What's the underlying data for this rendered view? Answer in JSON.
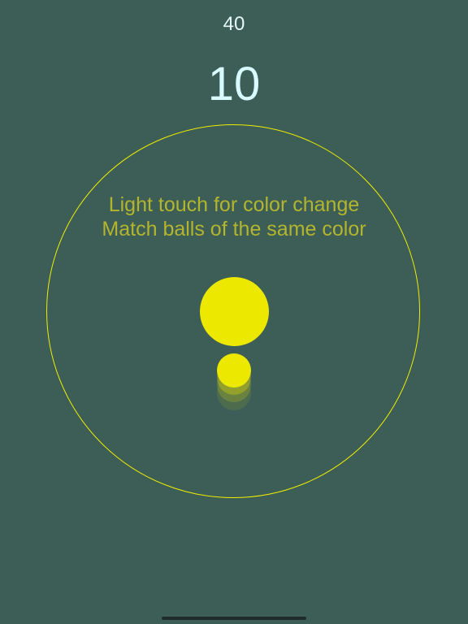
{
  "hud": {
    "best_score": "40",
    "score": "10"
  },
  "instructions": {
    "line1": "Light touch for color change",
    "line2": "Match balls of the same color"
  },
  "colors": {
    "background": "#3c5e57",
    "ball": "#ede800",
    "ring": "#f0ee00",
    "instruction_text": "#b3b52c",
    "score_text": "#d8fbff"
  }
}
